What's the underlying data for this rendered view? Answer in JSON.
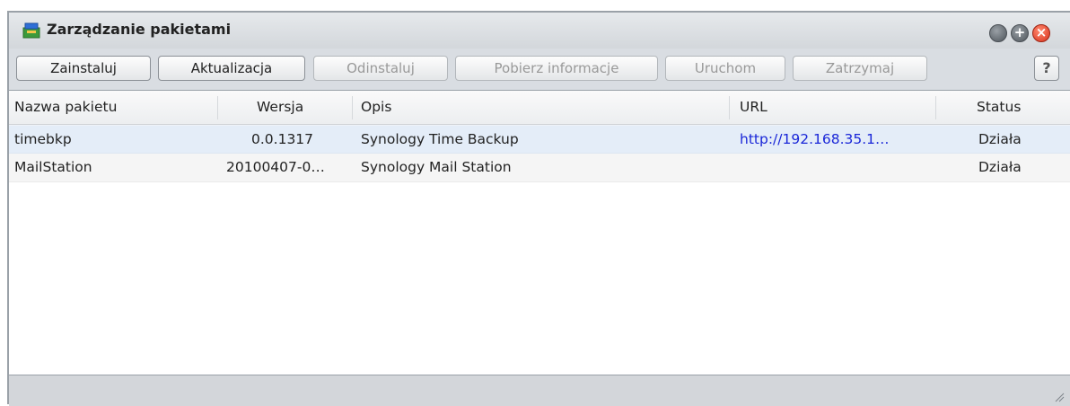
{
  "window": {
    "title": "Zarządzanie pakietami",
    "icon": "package-icon",
    "controls": [
      "minimize-icon",
      "maximize-icon",
      "close-icon"
    ]
  },
  "toolbar": {
    "install": "Zainstaluj",
    "update": "Aktualizacja",
    "uninstall": "Odinstaluj",
    "get_info": "Pobierz informacje",
    "run": "Uruchom",
    "stop": "Zatrzymaj",
    "help": "?"
  },
  "table": {
    "columns": {
      "name": "Nazwa pakietu",
      "version": "Wersja",
      "description": "Opis",
      "url": "URL",
      "status": "Status"
    },
    "rows": [
      {
        "name": "timebkp",
        "version": "0.0.1317",
        "description": "Synology Time Backup",
        "url": "http://192.168.35.1…",
        "status": "Działa"
      },
      {
        "name": "MailStation",
        "version": "20100407-0…",
        "description": "Synology Mail Station",
        "url": "",
        "status": "Działa"
      }
    ]
  },
  "colors": {
    "selected_row": "#e4edf8",
    "link": "#1a27d8",
    "close_button": "#d8321d"
  }
}
